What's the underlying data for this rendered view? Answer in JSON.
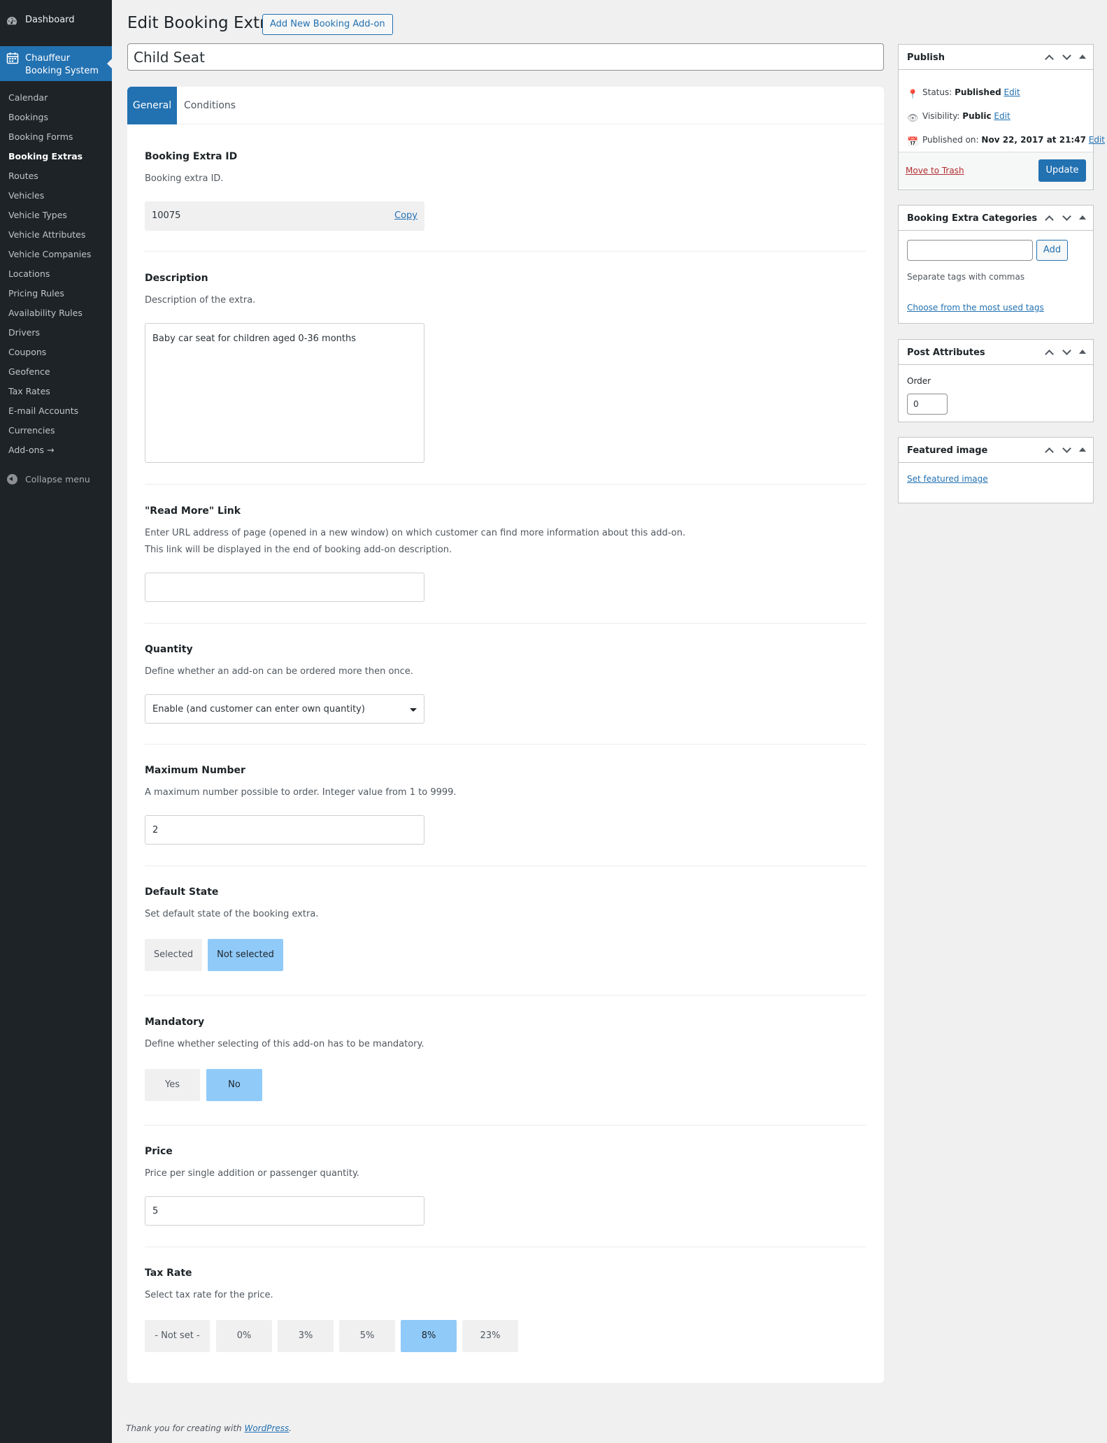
{
  "menu": {
    "dashboard": "Dashboard",
    "plugin": "Chauffeur Booking System",
    "plugin_line1": "Chauffeur",
    "plugin_line2": "Booking System",
    "items": [
      "Calendar",
      "Bookings",
      "Booking Forms",
      "Booking Extras",
      "Routes",
      "Vehicles",
      "Vehicle Types",
      "Vehicle Attributes",
      "Vehicle Companies",
      "Locations",
      "Pricing Rules",
      "Availability Rules",
      "Drivers",
      "Coupons",
      "Geofence",
      "Tax Rates",
      "E-mail Accounts",
      "Currencies",
      "Add-ons →"
    ],
    "current": "Booking Extras",
    "collapse": "Collapse menu"
  },
  "header": {
    "title": "Edit Booking Extra",
    "add_new": "Add New Booking Add-on"
  },
  "post_title": "Child Seat",
  "tabs": [
    "General",
    "Conditions"
  ],
  "fields": {
    "extra_id": {
      "title": "Booking Extra ID",
      "desc": "Booking extra ID.",
      "value": "10075",
      "copy": "Copy"
    },
    "description": {
      "title": "Description",
      "desc": "Description of the extra.",
      "value": "Baby car seat for children aged 0-36 months"
    },
    "read_more": {
      "title": "\"Read More\" Link",
      "desc1": "Enter URL address of page (opened in a new window) on which customer can find more information about this add-on.",
      "desc2": "This link will be displayed in the end of booking add-on description.",
      "value": ""
    },
    "quantity": {
      "title": "Quantity",
      "desc": "Define whether an add-on can be ordered more then once.",
      "value": "Enable (and customer can enter own quantity)"
    },
    "max_number": {
      "title": "Maximum Number",
      "desc": "A maximum number possible to order. Integer value from 1 to 9999.",
      "value": "2"
    },
    "default_state": {
      "title": "Default State",
      "desc": "Set default state of the booking extra.",
      "options": [
        "Selected",
        "Not selected"
      ],
      "selected": "Not selected"
    },
    "mandatory": {
      "title": "Mandatory",
      "desc": "Define whether selecting of this add-on has to be mandatory.",
      "options": [
        "Yes",
        "No"
      ],
      "selected": "No"
    },
    "price": {
      "title": "Price",
      "desc": "Price per single addition or passenger quantity.",
      "value": "5"
    },
    "tax_rate": {
      "title": "Tax Rate",
      "desc": "Select tax rate for the price.",
      "options": [
        "- Not set -",
        "0%",
        "3%",
        "5%",
        "8%",
        "23%"
      ],
      "selected": "8%"
    }
  },
  "publish": {
    "heading": "Publish",
    "status_label": "Status:",
    "status_value": "Published",
    "visibility_label": "Visibility:",
    "visibility_value": "Public",
    "published_label": "Published on:",
    "published_value": "Nov 22, 2017 at 21:47",
    "edit": "Edit",
    "trash": "Move to Trash",
    "update": "Update"
  },
  "categories": {
    "heading": "Booking Extra Categories",
    "add": "Add",
    "hint": "Separate tags with commas",
    "most_used": "Choose from the most used tags"
  },
  "attributes": {
    "heading": "Post Attributes",
    "order_label": "Order",
    "order_value": "0"
  },
  "featured": {
    "heading": "Featured image",
    "link": "Set featured image"
  },
  "footer": {
    "text": "Thank you for creating with",
    "link": "WordPress",
    "suffix": "."
  },
  "colors": {
    "accent": "#2271b1",
    "menu_bg": "#1d2327",
    "selected_segment": "#90caf9",
    "danger": "#b32d2e"
  }
}
